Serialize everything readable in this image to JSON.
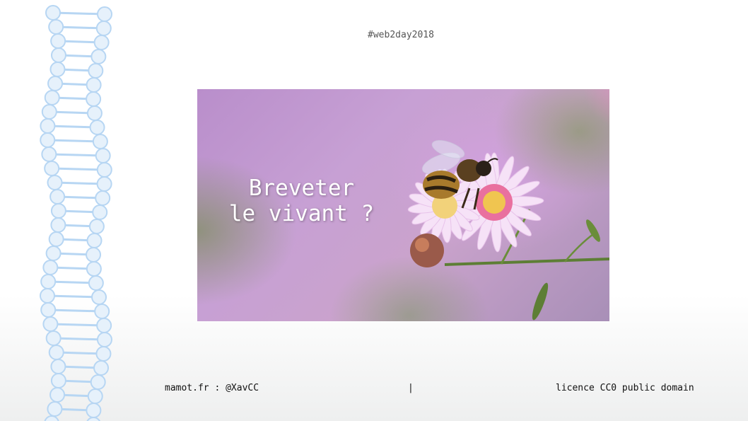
{
  "header": {
    "hashtag": "#web2day2018"
  },
  "slide": {
    "title_line1": "Breveter",
    "title_line2": "le vivant ?",
    "image_icon": "bee-on-flower-photo",
    "side_icon": "dna-helix-icon"
  },
  "footer": {
    "author": "mamot.fr : @XavCC",
    "separator": "|",
    "license": "licence CC0 public domain"
  },
  "colors": {
    "dna": "#b7d6f3",
    "text": "#111111",
    "hashtag": "#555555"
  }
}
